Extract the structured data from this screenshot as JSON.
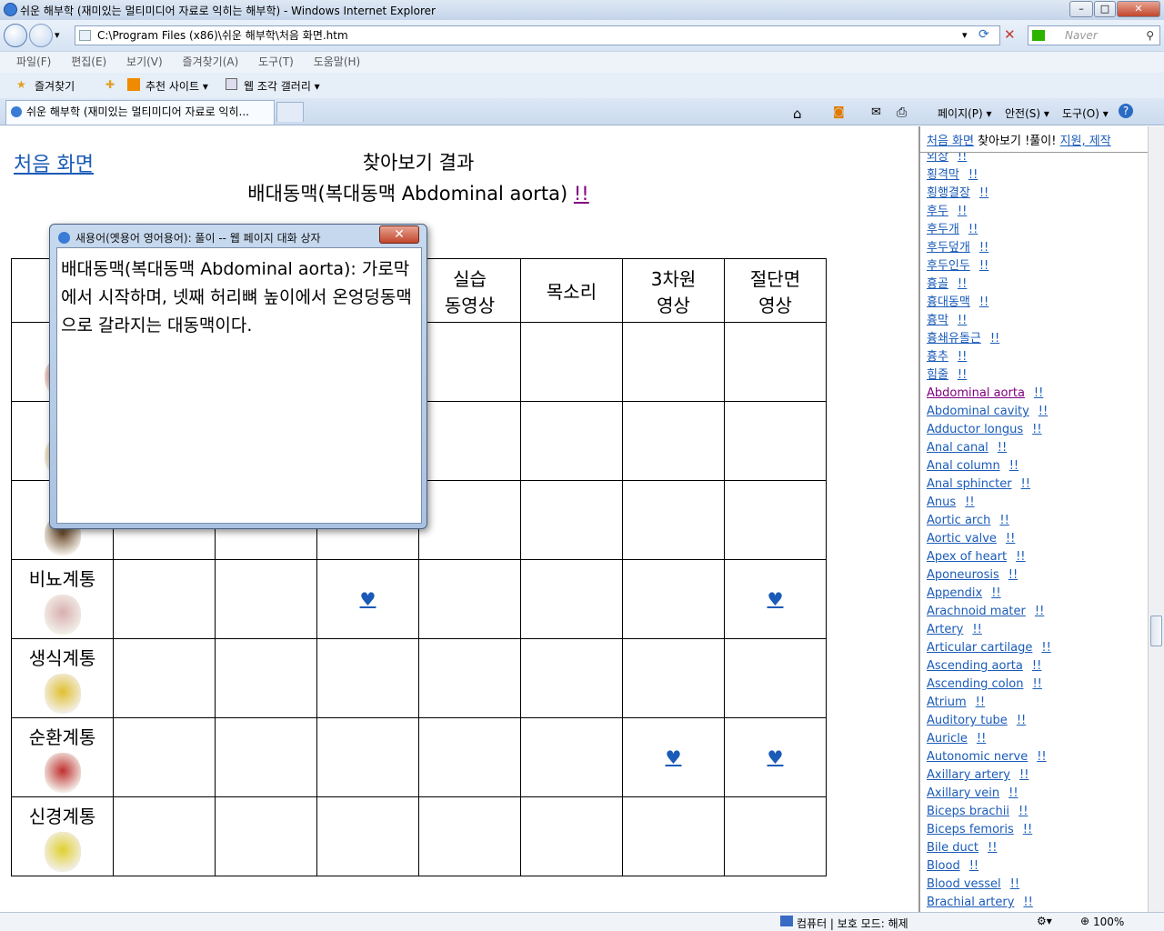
{
  "window": {
    "title": "쉬운 해부학 (재미있는 멀티미디어 자료로 익히는 해부학) - Windows Internet Explorer",
    "address": "C:\\Program Files (x86)\\쉬운 해부학\\처음 화면.htm",
    "search_placeholder": "Naver"
  },
  "menu": [
    "파일(F)",
    "편집(E)",
    "보기(V)",
    "즐겨찾기(A)",
    "도구(T)",
    "도움말(H)"
  ],
  "favbar": {
    "favorites": "즐겨찾기",
    "suggested": "추천 사이트 ▾",
    "gallery": "웹 조각 갤러리 ▾"
  },
  "tab": {
    "label": "쉬운 해부학 (재미있는 멀티미디어 자료로 익히..."
  },
  "commandbar": {
    "page": "페이지(P) ▾",
    "safety": "안전(S) ▾",
    "tools": "도구(O) ▾"
  },
  "main": {
    "home_link": "처음 화면",
    "heading": "찾아보기 결과",
    "term": "배대동맥(복대동맥 Abdominal aorta)",
    "bang": "!!",
    "headers": [
      "",
      "",
      "",
      "",
      "실습\n동영상",
      "목소리",
      "3차원\n영상",
      "절단면\n영상"
    ],
    "rows": [
      {
        "system": "근",
        "hearts": [
          0,
          0,
          0,
          0,
          0,
          0,
          0
        ]
      },
      {
        "system": "소",
        "hearts": [
          0,
          0,
          0,
          0,
          0,
          0,
          0
        ]
      },
      {
        "system": "호",
        "hearts": [
          0,
          0,
          0,
          0,
          0,
          0,
          0
        ]
      },
      {
        "system": "비뇨계통",
        "hearts": [
          0,
          0,
          1,
          0,
          0,
          0,
          1
        ]
      },
      {
        "system": "생식계통",
        "hearts": [
          0,
          0,
          0,
          0,
          0,
          0,
          0
        ]
      },
      {
        "system": "순환계통",
        "hearts": [
          0,
          0,
          0,
          0,
          0,
          1,
          1
        ]
      },
      {
        "system": "신경계통",
        "hearts": [
          0,
          0,
          0,
          0,
          0,
          0,
          0
        ]
      }
    ],
    "heart_glyph": "♥",
    "organ_colors": [
      "#c0392b",
      "#d9a24a",
      "#6a4a2a",
      "#d8b0b0",
      "#e0c030",
      "#c03030",
      "#e0d030"
    ]
  },
  "dialog": {
    "title": "새용어(옛용어 영어용어): 풀이 -- 웹 페이지 대화 상자",
    "close": "✕",
    "text": "배대동맥(복대동맥 Abdominal aorta): 가로막에서 시작하며, 넷째 허리뼈 높이에서 온엉덩동맥으로 갈라지는 대동맥이다."
  },
  "sidebar": {
    "home": "처음 화면",
    "mid": " 찾아보기 !풀이! ",
    "support": "지원, 제작",
    "bang": "!!",
    "words": [
      "외상",
      "횡격막",
      "횡행결장",
      "후두",
      "후두개",
      "후두덮개",
      "후두인두",
      "흉골",
      "흉대동맥",
      "흉막",
      "흉쇄유돌근",
      "흉추",
      "힘줄",
      "Abdominal aorta",
      "Abdominal cavity",
      "Adductor longus",
      "Anal canal",
      "Anal column",
      "Anal sphincter",
      "Anus",
      "Aortic arch",
      "Aortic valve",
      "Apex of heart",
      "Aponeurosis",
      "Appendix",
      "Arachnoid mater",
      "Artery",
      "Articular cartilage",
      "Ascending aorta",
      "Ascending colon",
      "Atrium",
      "Auditory tube",
      "Auricle",
      "Autonomic nerve",
      "Axillary artery",
      "Axillary vein",
      "Biceps brachii",
      "Biceps femoris",
      "Bile duct",
      "Blood",
      "Blood vessel",
      "Brachial artery"
    ],
    "visited": "Abdominal aorta"
  },
  "status": {
    "zone": "컴퓨터 | 보호 모드: 해제",
    "zoom": "100%"
  }
}
